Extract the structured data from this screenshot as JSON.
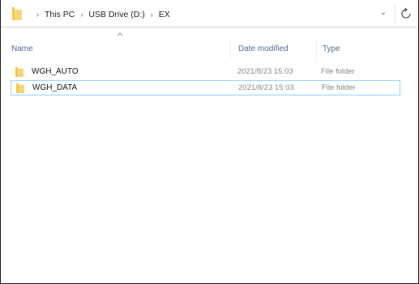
{
  "address_bar": {
    "folder_icon": "folder-icon",
    "separator_icon": "chevron-right-icon",
    "crumbs": [
      "This PC",
      "USB Drive (D:)",
      "EX"
    ],
    "dropdown_icon": "chevron-down-icon",
    "refresh_icon": "refresh-icon"
  },
  "columns": {
    "name": "Name",
    "date_modified": "Date modified",
    "type": "Type",
    "sort_icon": "sort-up-arrow-icon"
  },
  "files": [
    {
      "name": "WGH_AUTO",
      "date": "2021/8/23 15:03",
      "type": "File folder",
      "icon": "folder-icon",
      "selected": false
    },
    {
      "name": "WGH_DATA",
      "date": "2021/8/23 15:03",
      "type": "File folder",
      "icon": "folder-icon",
      "selected": true
    }
  ],
  "colors": {
    "folder": "#f2c94c",
    "header_text": "#4d6f94",
    "selection_border": "#99d1ff"
  }
}
